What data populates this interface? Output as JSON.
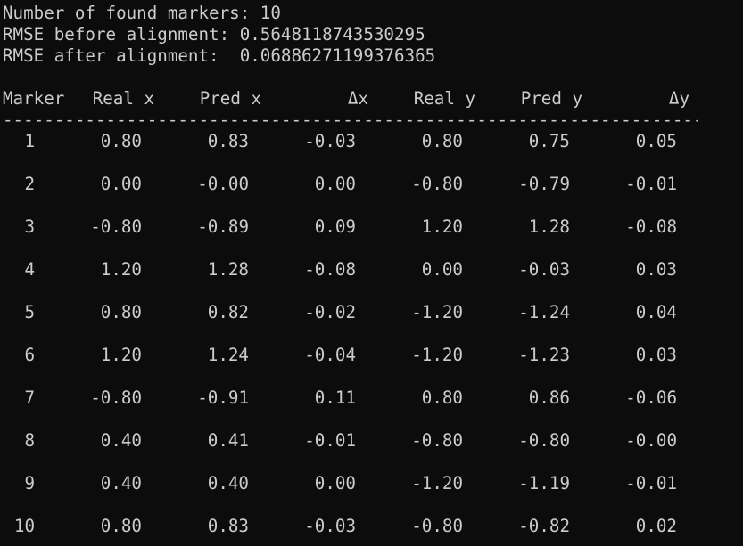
{
  "summary": {
    "markers_line": "Number of found markers: 10",
    "rmse_before_line": "RMSE before alignment: 0.5648118743530295",
    "rmse_after_line": "RMSE after alignment:  0.06886271199376365"
  },
  "table": {
    "headers": [
      "Marker",
      "Real x",
      "Pred x",
      "Δx",
      "Real y",
      "Pred y",
      "Δy"
    ],
    "separator": "---------------------------------------------------------------------",
    "rows": [
      [
        "1",
        "0.80",
        "0.83",
        "-0.03",
        "0.80",
        "0.75",
        "0.05"
      ],
      [
        "2",
        "0.00",
        "-0.00",
        "0.00",
        "-0.80",
        "-0.79",
        "-0.01"
      ],
      [
        "3",
        "-0.80",
        "-0.89",
        "0.09",
        "1.20",
        "1.28",
        "-0.08"
      ],
      [
        "4",
        "1.20",
        "1.28",
        "-0.08",
        "0.00",
        "-0.03",
        "0.03"
      ],
      [
        "5",
        "0.80",
        "0.82",
        "-0.02",
        "-1.20",
        "-1.24",
        "0.04"
      ],
      [
        "6",
        "1.20",
        "1.24",
        "-0.04",
        "-1.20",
        "-1.23",
        "0.03"
      ],
      [
        "7",
        "-0.80",
        "-0.91",
        "0.11",
        "0.80",
        "0.86",
        "-0.06"
      ],
      [
        "8",
        "0.40",
        "0.41",
        "-0.01",
        "-0.80",
        "-0.80",
        "-0.00"
      ],
      [
        "9",
        "0.40",
        "0.40",
        "0.00",
        "-1.20",
        "-1.19",
        "-0.01"
      ],
      [
        "10",
        "0.80",
        "0.83",
        "-0.03",
        "-0.80",
        "-0.82",
        "0.02"
      ]
    ]
  }
}
